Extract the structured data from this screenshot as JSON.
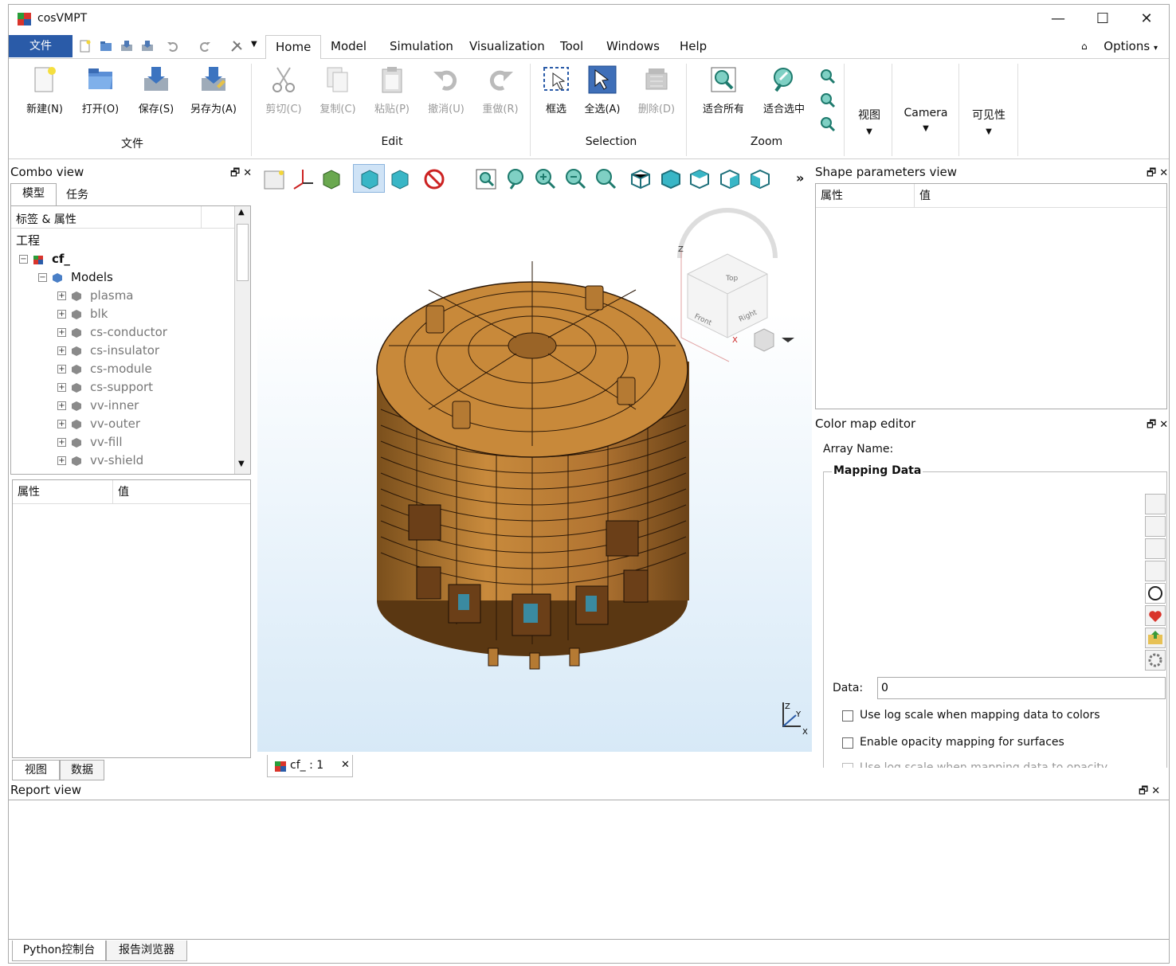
{
  "window": {
    "title": "cosVMPT",
    "minimize": "—",
    "maximize": "☐",
    "close": "✕"
  },
  "menu": {
    "file": "文件",
    "items": [
      {
        "label": "Home",
        "active": true
      },
      {
        "label": "Model"
      },
      {
        "label": "Simulation"
      },
      {
        "label": "Visualization"
      },
      {
        "label": "Tool"
      },
      {
        "label": "Windows"
      },
      {
        "label": "Help"
      }
    ],
    "options": "Options"
  },
  "ribbon": {
    "buttons": [
      {
        "name": "new",
        "label": "新建(N)",
        "icon": "new-file-icon"
      },
      {
        "name": "open",
        "label": "打开(O)",
        "icon": "folder-open-icon"
      },
      {
        "name": "save",
        "label": "保存(S)",
        "icon": "save-icon"
      },
      {
        "name": "save-as",
        "label": "另存为(A)",
        "icon": "save-as-icon"
      },
      {
        "name": "cut",
        "label": "剪切(C)",
        "icon": "scissors-icon"
      },
      {
        "name": "copy",
        "label": "复制(C)",
        "icon": "copy-icon"
      },
      {
        "name": "paste",
        "label": "粘贴(P)",
        "icon": "paste-icon"
      },
      {
        "name": "undo",
        "label": "撤消(U)",
        "icon": "undo-icon"
      },
      {
        "name": "redo",
        "label": "重做(R)",
        "icon": "redo-icon"
      },
      {
        "name": "box-select",
        "label": "框选",
        "icon": "box-select-icon"
      },
      {
        "name": "select-all",
        "label": "全选(A)",
        "icon": "cursor-icon"
      },
      {
        "name": "delete",
        "label": "删除(D)",
        "icon": "delete-icon"
      },
      {
        "name": "fit-all",
        "label": "适合所有",
        "icon": "zoom-fit-all-icon"
      },
      {
        "name": "fit-selection",
        "label": "适合选中",
        "icon": "zoom-fit-selection-icon"
      }
    ],
    "groups": [
      "文件",
      "Edit",
      "Selection",
      "Zoom"
    ],
    "dropdowns": [
      "视图",
      "Camera",
      "可见性"
    ]
  },
  "combo_view": {
    "title": "Combo view",
    "tabs": [
      "模型",
      "任务"
    ],
    "tree_header": "标签 & 属性",
    "project_label": "工程",
    "root": "cf_",
    "models_label": "Models",
    "models": [
      "plasma",
      "blk",
      "cs-conductor",
      "cs-insulator",
      "cs-module",
      "cs-support",
      "vv-inner",
      "vv-outer",
      "vv-fill",
      "vv-shield"
    ],
    "prop_headers": [
      "属性",
      "值"
    ],
    "bottom_tabs": [
      "视图",
      "数据"
    ]
  },
  "viewport": {
    "doc_tab": "cf_ : 1",
    "cube_faces": [
      "Top",
      "Front",
      "Right"
    ],
    "axis_labels": [
      "Z",
      "X",
      "Y"
    ],
    "mini_axis_labels": [
      "Z",
      "Y",
      "X"
    ],
    "model_color": "#c88a3c",
    "bg_top": "#ffffff",
    "bg_bottom": "#d7e9f7"
  },
  "shape_params": {
    "title": "Shape parameters view",
    "headers": [
      "属性",
      "值"
    ]
  },
  "color_map": {
    "title": "Color map editor",
    "array_name_label": "Array Name:",
    "mapping_label": "Mapping Data",
    "data_label": "Data:",
    "data_value": "0",
    "log_scale_label": "Use log scale when mapping data to colors",
    "opacity_label": "Enable opacity mapping for surfaces",
    "log_opacity_label": "Use log scale when mapping data to opacity"
  },
  "report_view": {
    "title": "Report view",
    "tabs": [
      "Python控制台",
      "报告浏览器"
    ]
  }
}
